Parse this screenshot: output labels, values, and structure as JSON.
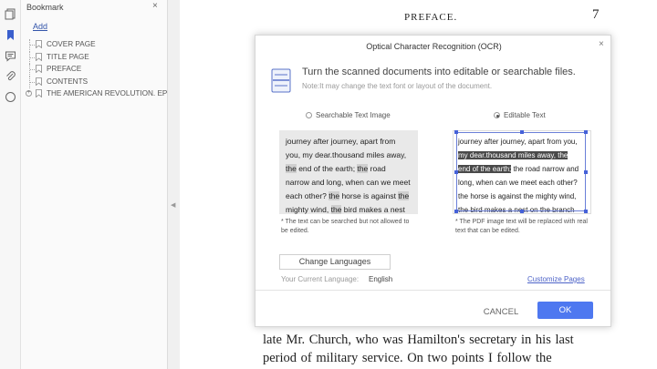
{
  "sidebar_panel": {
    "title": "Bookmark",
    "close_label": "×",
    "add_label": "Add",
    "items": [
      {
        "label": "COVER PAGE"
      },
      {
        "label": "TITLE PAGE"
      },
      {
        "label": "PREFACE"
      },
      {
        "label": "CONTENTS"
      },
      {
        "label": "THE AMERICAN REVOLUTION. EP"
      }
    ],
    "expander_label": "+"
  },
  "rail_icons": [
    "pages-icon",
    "bookmark-icon",
    "comment-icon",
    "attachment-icon",
    "search-icon"
  ],
  "document": {
    "header": "PREFACE.",
    "page_number": "7",
    "lines": [
      "late Mr. Church, who was Hamilton's secretary in his last",
      "period of military service.   On two points I follow the"
    ]
  },
  "ocr_dialog": {
    "title": "Optical Character Recognition (OCR)",
    "close_label": "×",
    "heading": "Turn the scanned documents into editable or searchable files.",
    "note": "Note:It may change the text font or layout of the document.",
    "options": [
      {
        "label": "Searchable Text Image",
        "selected": false
      },
      {
        "label": "Editable Text",
        "selected": true
      }
    ],
    "left_sample": {
      "lines": [
        [
          {
            "t": "journey after journey, apart from"
          }
        ],
        [
          {
            "t": "you, my dear.thousand miles away,"
          }
        ],
        [
          {
            "t": "the",
            "hl": true
          },
          {
            "t": " end of the earth; "
          },
          {
            "t": "the",
            "hl": true
          },
          {
            "t": " road"
          }
        ],
        [
          {
            "t": "narrow and long, when can we meet"
          }
        ],
        [
          {
            "t": "each other? "
          },
          {
            "t": "the",
            "hl": true
          },
          {
            "t": " horse is against "
          },
          {
            "t": "the",
            "hl": true
          }
        ],
        [
          {
            "t": "mighty wind, "
          },
          {
            "t": "the",
            "hl": true
          },
          {
            "t": " bird makes a nest"
          }
        ]
      ],
      "caption": "* The text can be searched but not allowed to be edited."
    },
    "right_sample": {
      "lines": [
        [
          {
            "t": "journey after journey, apart from you,"
          }
        ],
        [
          {
            "t": "my dear.thousand miles away, the",
            "sel": true
          }
        ],
        [
          {
            "t": "end of the earth;",
            "sel": true
          },
          {
            "t": " the road narrow and"
          }
        ],
        [
          {
            "t": "long, when can we meet each other?"
          }
        ],
        [
          {
            "t": "the horse is against the mighty wind,"
          }
        ],
        [
          {
            "t": "the bird makes a nest on the branch"
          }
        ]
      ],
      "caption": "* The PDF image text will be replaced with real text that can be edited."
    },
    "change_languages_label": "Change Languages",
    "current_language_label": "Your Current Language:",
    "current_language": "English",
    "customize_pages_label": "Customize Pages",
    "cancel_label": "CANCEL",
    "ok_label": "OK"
  },
  "colors": {
    "accent": "#4e78f0",
    "link": "#4d63c8",
    "selection": "#4a4a4a"
  }
}
